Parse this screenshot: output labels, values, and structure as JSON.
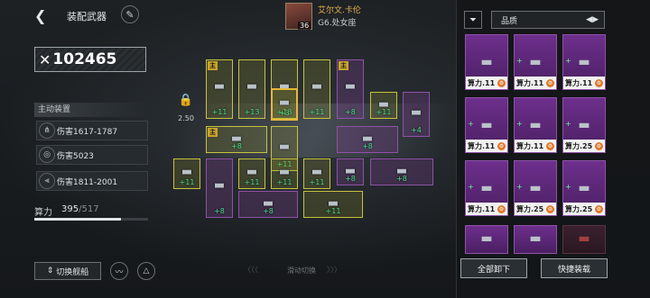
{
  "header": {
    "back_icon": "back-arrow-icon",
    "title": "装配武器",
    "edit_icon": "pencil-icon"
  },
  "commander": {
    "level": "36",
    "name": "艾尔文.卡伦",
    "subtitle": "G6.处女座"
  },
  "combat_power": {
    "icon": "crossed-swords-icon",
    "value": "102465"
  },
  "left_panel": {
    "section_title": "主动装置",
    "stats": [
      {
        "icon": "triple-claw-icon",
        "text": "伤害1617-1787"
      },
      {
        "icon": "target-ring-icon",
        "text": "伤害5023"
      },
      {
        "icon": "triple-missile-icon",
        "text": "伤害1811-2001"
      }
    ],
    "capacity_label": "算力",
    "capacity_current": "395",
    "capacity_max": "/517",
    "capacity_fraction": 0.764
  },
  "lock": {
    "value": "2.50"
  },
  "bottom_bar": {
    "switch_ship": "切换舰船",
    "swipe_hint": "滑动切换"
  },
  "grid_slots": [
    {
      "color": "y",
      "main": "主",
      "level": "+11"
    },
    {
      "color": "y",
      "main": "",
      "level": "+13"
    },
    {
      "color": "y",
      "main": "",
      "level": "+13"
    },
    {
      "color": "y",
      "main": "",
      "level": "+11"
    },
    {
      "color": "p",
      "main": "主",
      "level": "+8"
    },
    {
      "color": "y",
      "main": "",
      "level": "+3"
    },
    {
      "color": "y",
      "main": "",
      "level": "+11"
    },
    {
      "color": "p",
      "main": "",
      "level": "+4"
    },
    {
      "color": "y",
      "main": "主",
      "level": "+8"
    },
    {
      "color": "y",
      "main": "",
      "level": "+11"
    },
    {
      "color": "p",
      "main": "",
      "level": "+8"
    },
    {
      "color": "y",
      "main": "",
      "level": "+11"
    },
    {
      "color": "p",
      "main": "",
      "level": "+8"
    },
    {
      "color": "y",
      "main": "",
      "level": "+11"
    },
    {
      "color": "y",
      "main": "",
      "level": "+11"
    },
    {
      "color": "y",
      "main": "",
      "level": "+11"
    },
    {
      "color": "p",
      "main": "",
      "level": "+8"
    },
    {
      "color": "p",
      "main": "",
      "level": "+8"
    },
    {
      "color": "p",
      "main": "",
      "level": "+8"
    },
    {
      "color": "y",
      "main": "",
      "level": "+11"
    }
  ],
  "right_panel": {
    "filter_icon": "funnel-icon",
    "sort_label": "品质",
    "sort_icon": "sort-toggle-icon",
    "items": [
      {
        "cap": "算力.11",
        "badge": ""
      },
      {
        "cap": "算力.11",
        "badge": "+"
      },
      {
        "cap": "算力.11",
        "badge": "+"
      },
      {
        "cap": "算力.11",
        "badge": "+"
      },
      {
        "cap": "算力.11",
        "badge": "+"
      },
      {
        "cap": "算力.25",
        "badge": "+"
      },
      {
        "cap": "算力.11",
        "badge": "+"
      },
      {
        "cap": "算力.25",
        "badge": "+"
      },
      {
        "cap": "算力.25",
        "badge": "+"
      }
    ],
    "unequip_all": "全部卸下",
    "quick_equip": "快捷装载"
  },
  "colors": {
    "yellow_slot": "#c7c23e",
    "purple_slot": "#8e52a6",
    "level_green": "#46e08a",
    "name_gold": "#e9b34a"
  }
}
